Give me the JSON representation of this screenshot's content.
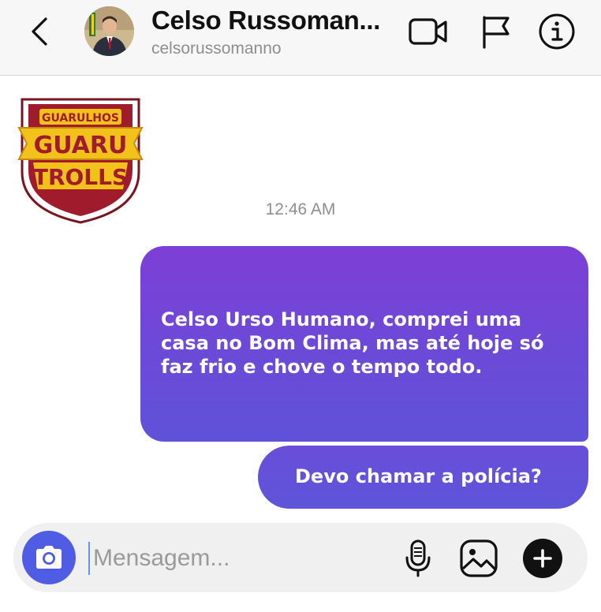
{
  "header": {
    "contact_name": "Celso Russoman...",
    "contact_handle": "celsorussomanno",
    "icons": [
      "back-icon",
      "video-call-icon",
      "flag-icon",
      "info-icon"
    ]
  },
  "sticker": {
    "logo_text": [
      "GUARULHOS",
      "GUARU",
      "TROLLS"
    ],
    "colors": {
      "shield": "#a01c2c",
      "banner": "#f2c21a",
      "outline": "#7a1420"
    }
  },
  "thread": {
    "timestamp": "12:46 AM",
    "messages": [
      {
        "text": "Celso Urso Humano, comprei uma casa no Bom Clima, mas até hoje só faz frio e chove o tempo todo."
      },
      {
        "text": "Devo chamar a polícia?"
      }
    ]
  },
  "composer": {
    "placeholder": "Mensagem...",
    "icons": [
      "camera-icon",
      "microphone-icon",
      "gallery-icon",
      "plus-icon"
    ]
  },
  "colors": {
    "bubble_top": "#7d3fd6",
    "bubble_bottom": "#5f52d8",
    "camera_button": "#4f5de4",
    "header_bg": "#f7f7f7"
  }
}
